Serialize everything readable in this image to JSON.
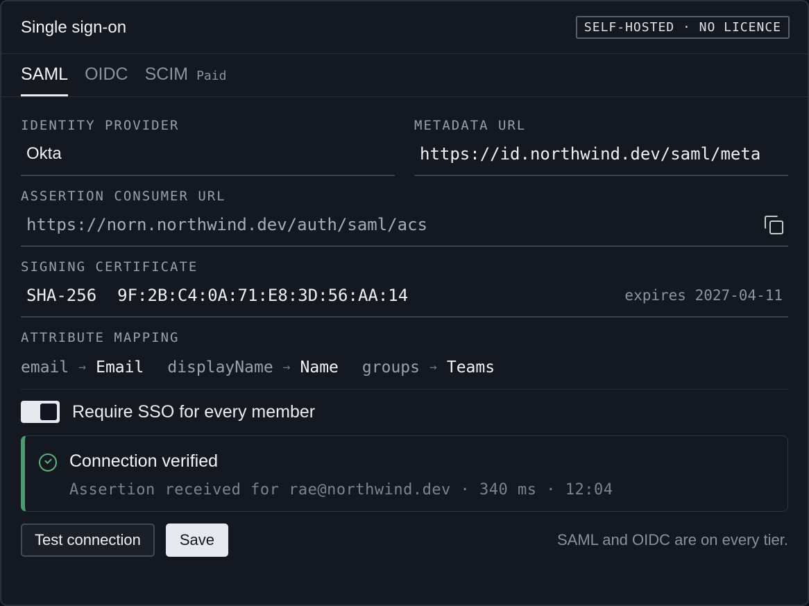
{
  "header": {
    "title": "Single sign-on",
    "badge": "SELF-HOSTED · NO LICENCE"
  },
  "tabs": [
    {
      "label": "SAML",
      "active": true
    },
    {
      "label": "OIDC",
      "active": false
    },
    {
      "label": "SCIM",
      "active": false,
      "tag": "Paid"
    }
  ],
  "fields": {
    "identity_provider": {
      "label": "IDENTITY PROVIDER",
      "value": "Okta"
    },
    "metadata_url": {
      "label": "METADATA URL",
      "value": "https://id.northwind.dev/saml/meta"
    },
    "acs_url": {
      "label": "ASSERTION CONSUMER URL",
      "value": "https://norn.northwind.dev/auth/saml/acs",
      "icon": "copy-icon"
    },
    "signing_certificate": {
      "label": "SIGNING CERTIFICATE",
      "algorithm": "SHA-256",
      "fingerprint": "9F:2B:C4:0A:71:E8:3D:56:AA:14",
      "expires": "expires 2027-04-11"
    }
  },
  "attribute_mapping": {
    "label": "ATTRIBUTE MAPPING",
    "arrow": "→",
    "pairs": [
      {
        "source": "email",
        "target": "Email"
      },
      {
        "source": "displayName",
        "target": "Name"
      },
      {
        "source": "groups",
        "target": "Teams"
      }
    ]
  },
  "require_sso": {
    "label": "Require SSO for every member",
    "enabled": true
  },
  "verification": {
    "title": "Connection verified",
    "detail": "Assertion received for rae@northwind.dev · 340 ms · 12:04",
    "status_color": "#4f9a6d"
  },
  "actions": {
    "test_label": "Test connection",
    "save_label": "Save"
  },
  "footer_note": "SAML and OIDC are on every tier."
}
